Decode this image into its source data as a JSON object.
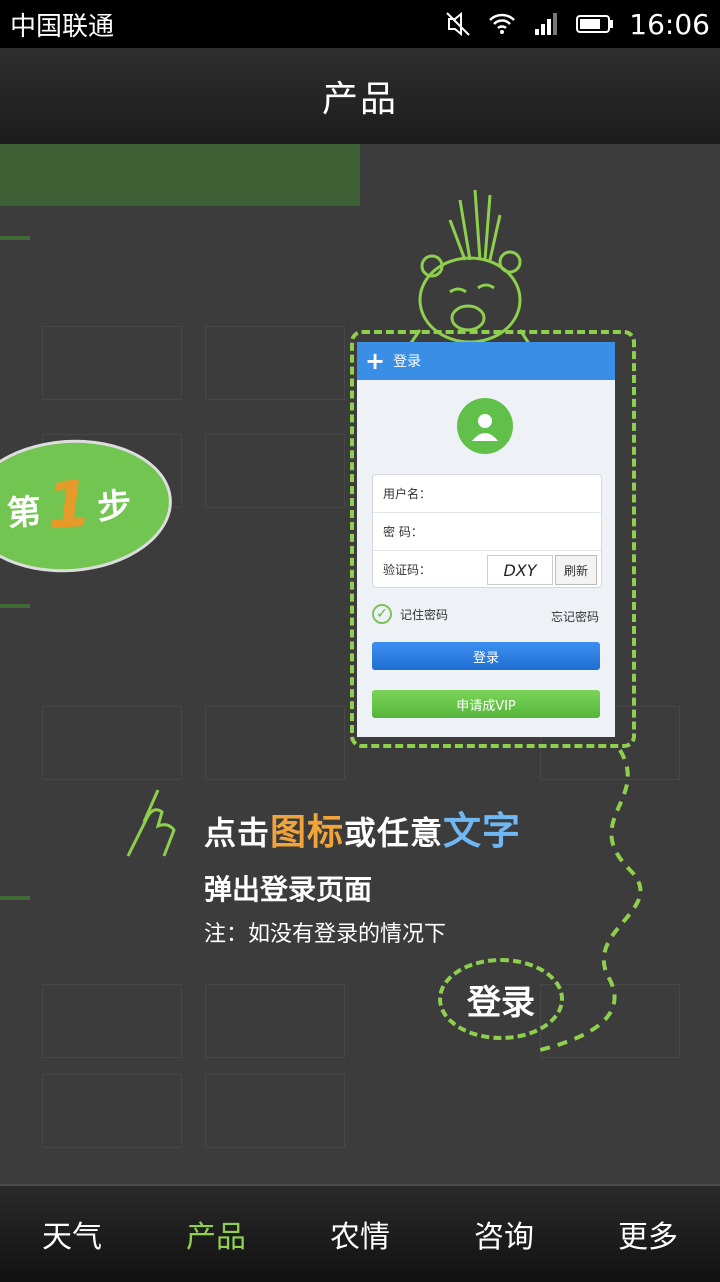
{
  "status_bar": {
    "carrier": "中国联通",
    "time": "16:06"
  },
  "header": {
    "title": "产品"
  },
  "step": {
    "prefix": "第",
    "number": "1",
    "suffix": "步"
  },
  "login_dialog": {
    "header": "登录",
    "username_label": "用户名：",
    "password_label": "密  码：",
    "captcha_label": "验证码：",
    "captcha_text": "DXY",
    "refresh": "刷新",
    "remember": "记住密码",
    "forgot": "忘记密码",
    "login_button": "登录",
    "vip_button": "申请成VIP"
  },
  "instructions": {
    "line1_a": "点击",
    "line1_b": "图标",
    "line1_c": "或任意",
    "line1_d": "文字",
    "line2": "弹出登录页面",
    "line3": "注：如没有登录的情况下",
    "bubble": "登录"
  },
  "nav": {
    "items": [
      "天气",
      "产品",
      "农情",
      "咨询",
      "更多"
    ],
    "active": "产品"
  },
  "colors": {
    "accent_green": "#8fd14f",
    "dialog_blue": "#3b8ee6"
  }
}
